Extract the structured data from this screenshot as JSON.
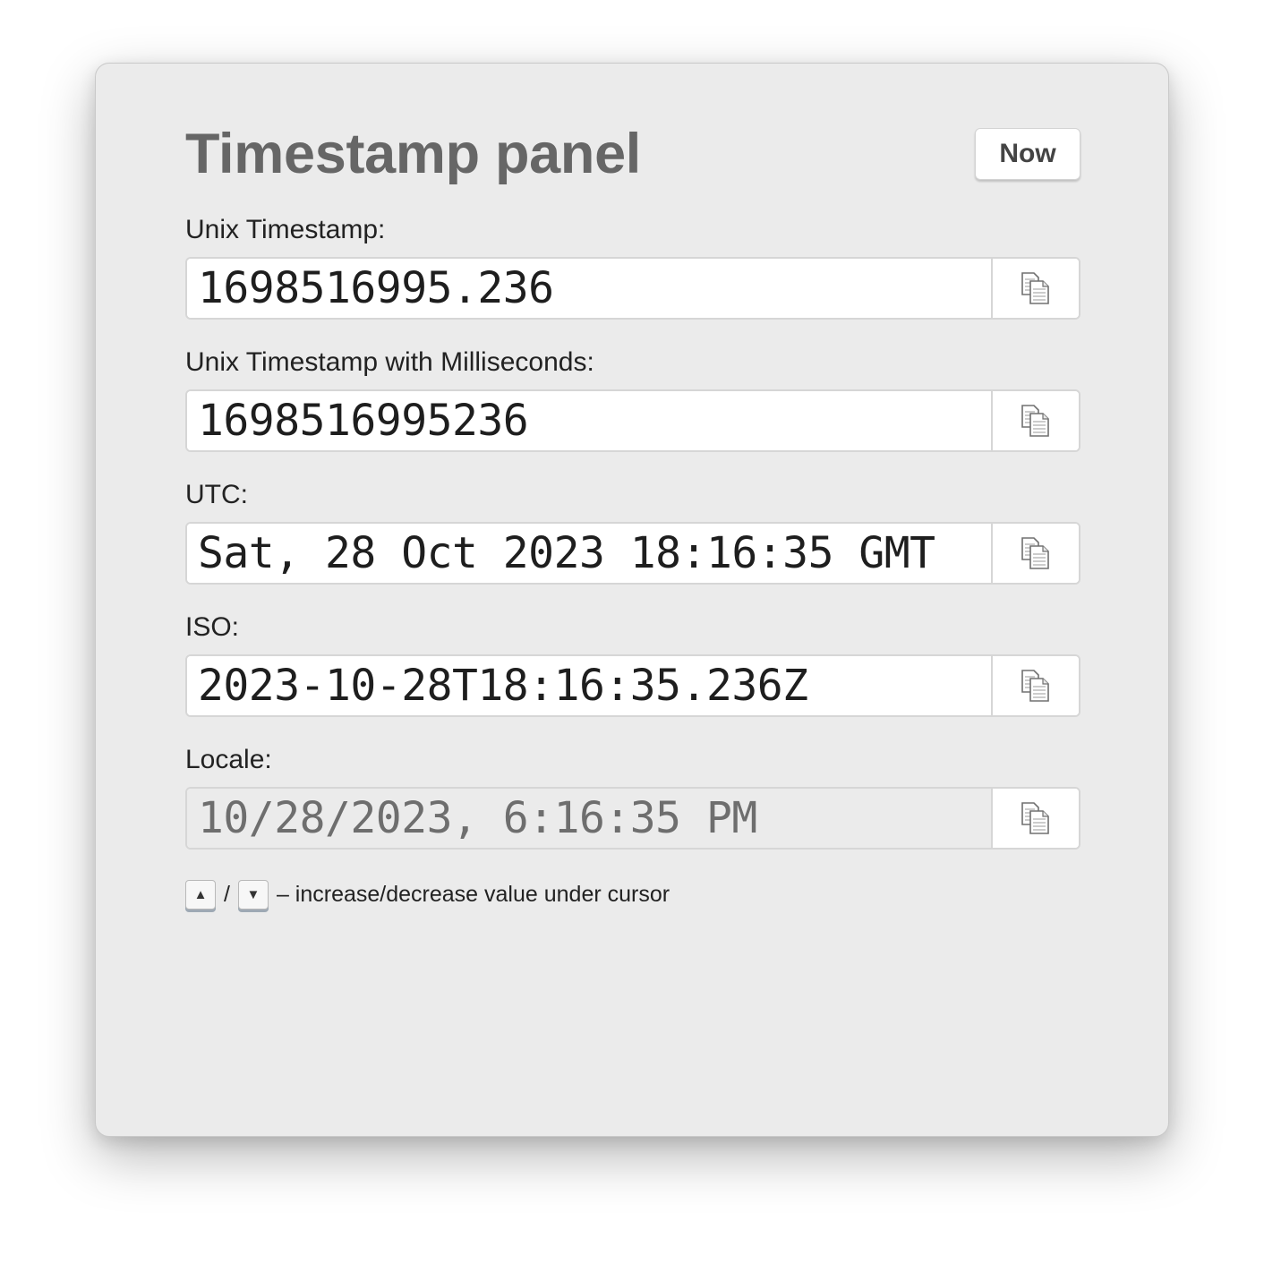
{
  "panel": {
    "title": "Timestamp panel",
    "now_button_label": "Now"
  },
  "fields": [
    {
      "label": "Unix Timestamp:",
      "value": "1698516995.236",
      "copy_icon": "copy-icon"
    },
    {
      "label": "Unix Timestamp with Milliseconds:",
      "value": "1698516995236",
      "copy_icon": "copy-icon"
    },
    {
      "label": "UTC:",
      "value": "Sat, 28 Oct 2023 18:16:35 GMT",
      "copy_icon": "copy-icon"
    },
    {
      "label": "ISO:",
      "value": "2023-10-28T18:16:35.236Z",
      "copy_icon": "copy-icon"
    },
    {
      "label": "Locale:",
      "value": "10/28/2023, 6:16:35 PM",
      "copy_icon": "copy-icon",
      "disabled": true
    }
  ],
  "hint": {
    "up_key": "▲",
    "separator": "/",
    "down_key": "▼",
    "text": "– increase/decrease value under cursor"
  },
  "colors": {
    "panel_background": "#ebebeb",
    "title": "#666666",
    "input_background": "#ffffff",
    "disabled_input_background": "#ebebeb"
  }
}
